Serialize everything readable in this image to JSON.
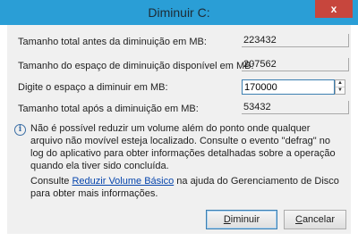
{
  "window": {
    "title": "Diminuir C:",
    "close_label": "x"
  },
  "fields": {
    "total_before_label": "Tamanho total antes da diminuição em MB:",
    "total_before_value": "223432",
    "available_label": "Tamanho do espaço de diminuição disponível em MB:",
    "available_value": "207562",
    "shrink_label": "Digite o espaço a diminuir em MB:",
    "shrink_value": "170000",
    "total_after_label": "Tamanho total após a diminuição em MB:",
    "total_after_value": "53432"
  },
  "info": {
    "text": "Não é possível reduzir um volume além do ponto onde qualquer arquivo não movível esteja localizado. Consulte o evento \"defrag\" no log do aplicativo para obter informações detalhadas sobre a operação quando ela tiver sido concluída."
  },
  "consult": {
    "prefix": "Consulte ",
    "link_text": "Reduzir Volume Básico",
    "suffix": " na ajuda do Gerenciamento de Disco para obter mais informações."
  },
  "buttons": {
    "shrink_first": "D",
    "shrink_rest": "iminuir",
    "cancel_first": "C",
    "cancel_rest": "ancelar"
  }
}
